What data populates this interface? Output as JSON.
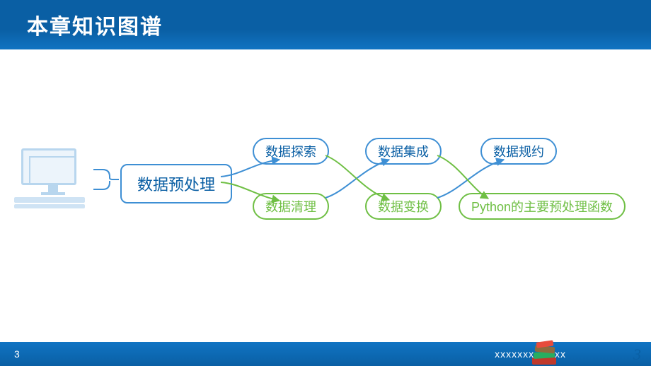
{
  "header": {
    "title": "本章知识图谱"
  },
  "root": {
    "label": "数据预处理"
  },
  "top_nodes": [
    {
      "label": "数据探索"
    },
    {
      "label": "数据集成"
    },
    {
      "label": "数据规约"
    }
  ],
  "bottom_nodes": [
    {
      "label": "数据清理"
    },
    {
      "label": "数据变换"
    },
    {
      "label": "Python的主要预处理函数"
    }
  ],
  "footer": {
    "page_left": "3",
    "masked_text": "xxxxxxx    xxxxx",
    "page_right": "3"
  }
}
